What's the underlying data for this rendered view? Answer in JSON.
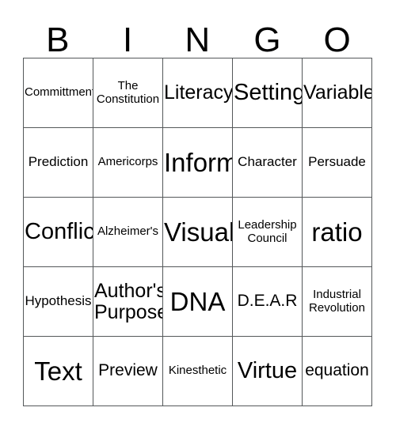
{
  "card": {
    "title": "BINGO",
    "header_letters": [
      "B",
      "I",
      "N",
      "G",
      "O"
    ],
    "columns": 5,
    "rows": 5,
    "colors": {
      "text": "#000000",
      "grid_line": "#55585a",
      "background": "#ffffff"
    },
    "cells": [
      [
        {
          "text": "Committment",
          "size": "xs"
        },
        {
          "text": "The\nConstitution",
          "size": "xs"
        },
        {
          "text": "Literacy",
          "size": "lg"
        },
        {
          "text": "Setting",
          "size": "xl"
        },
        {
          "text": "Variable",
          "size": "lg"
        }
      ],
      [
        {
          "text": "Prediction",
          "size": "sm"
        },
        {
          "text": "Americorps",
          "size": "xs"
        },
        {
          "text": "Inform",
          "size": "xxl"
        },
        {
          "text": "Character",
          "size": "sm"
        },
        {
          "text": "Persuade",
          "size": "sm"
        }
      ],
      [
        {
          "text": "Conflict",
          "size": "xl"
        },
        {
          "text": "Alzheimer's",
          "size": "xs"
        },
        {
          "text": "Visual",
          "size": "xxl"
        },
        {
          "text": "Leadership\nCouncil",
          "size": "xs"
        },
        {
          "text": "ratio",
          "size": "xxl"
        }
      ],
      [
        {
          "text": "Hypothesis",
          "size": "sm"
        },
        {
          "text": "Author's\nPurpose",
          "size": "lg"
        },
        {
          "text": "DNA",
          "size": "xxl"
        },
        {
          "text": "D.E.A.R",
          "size": "md"
        },
        {
          "text": "Industrial\nRevolution",
          "size": "xs"
        }
      ],
      [
        {
          "text": "Text",
          "size": "xxl"
        },
        {
          "text": "Preview",
          "size": "md"
        },
        {
          "text": "Kinesthetic",
          "size": "xs"
        },
        {
          "text": "Virtue",
          "size": "xl"
        },
        {
          "text": "equation",
          "size": "md"
        }
      ]
    ]
  }
}
